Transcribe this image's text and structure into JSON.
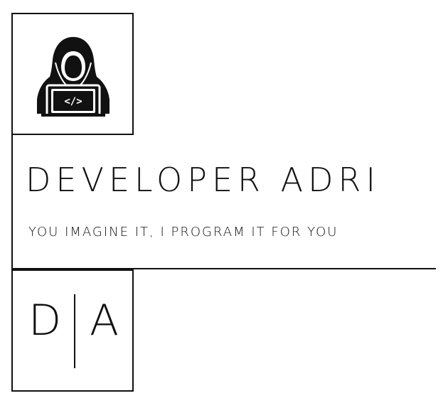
{
  "brand": {
    "title": "DEVELOPER ADRI",
    "tagline": "YOU IMAGINE IT, I PROGRAM IT FOR YOU",
    "initials": {
      "left": "D",
      "right": "A"
    }
  },
  "icons": {
    "logo": "hooded-hacker-laptop-icon",
    "laptop_symbol": "</>"
  },
  "colors": {
    "ink": "#111111",
    "background": "#ffffff"
  }
}
